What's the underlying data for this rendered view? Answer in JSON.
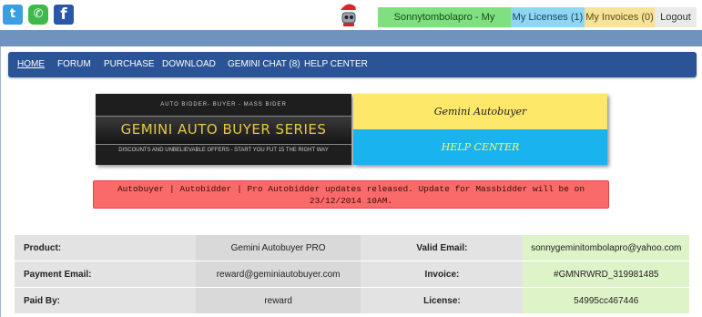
{
  "account_bar": {
    "user": "Sonnytombolapro - My account",
    "licenses": "My Licenses (1)",
    "invoices": "My Invoices (0)",
    "logout": "Logout",
    "colors": {
      "user": "#7ee07e",
      "licenses": "#8fd6f2",
      "invoices": "#f6e39a",
      "logout": "#eaeaea"
    }
  },
  "social": {
    "icons": [
      "twitter-icon",
      "whatsapp-icon",
      "facebook-icon"
    ]
  },
  "nav": {
    "items": [
      "HOME",
      "FORUM",
      "PURCHASE",
      "DOWNLOAD",
      "GEMINI CHAT (8)",
      "HELP CENTER"
    ],
    "active": "HOME",
    "color": "#2a5496"
  },
  "banner_left": {
    "top_text": "AUTO BIDDER- BUYER - MASS BIDER",
    "title": "GEMINI AUTO BUYER SERIES",
    "sub_text": "DISCOUNTS AND UNBELIEVABLE OFFERS - START YOU FUT 15 THE RIGHT WAY"
  },
  "banner_right": {
    "top": "Gemini Autobuyer",
    "bottom": "HELP CENTER"
  },
  "notice": "Autobuyer | Autobidder | Pro Autobidder updates released. Update for Massbidder will be on 23/12/2014 10AM.",
  "details": [
    {
      "label": "Product:",
      "value": "Gemini Autobuyer PRO",
      "label2": "Valid Email:",
      "value2": "sonnygeminitombolapro@yahoo.com"
    },
    {
      "label": "Payment Email:",
      "value": "reward@geminiautobuyer.com",
      "label2": "Invoice:",
      "value2": "#GMNRWRD_319981485"
    },
    {
      "label": "Paid By:",
      "value": "reward",
      "label2": "License:",
      "value2": "54995cc467446"
    }
  ]
}
